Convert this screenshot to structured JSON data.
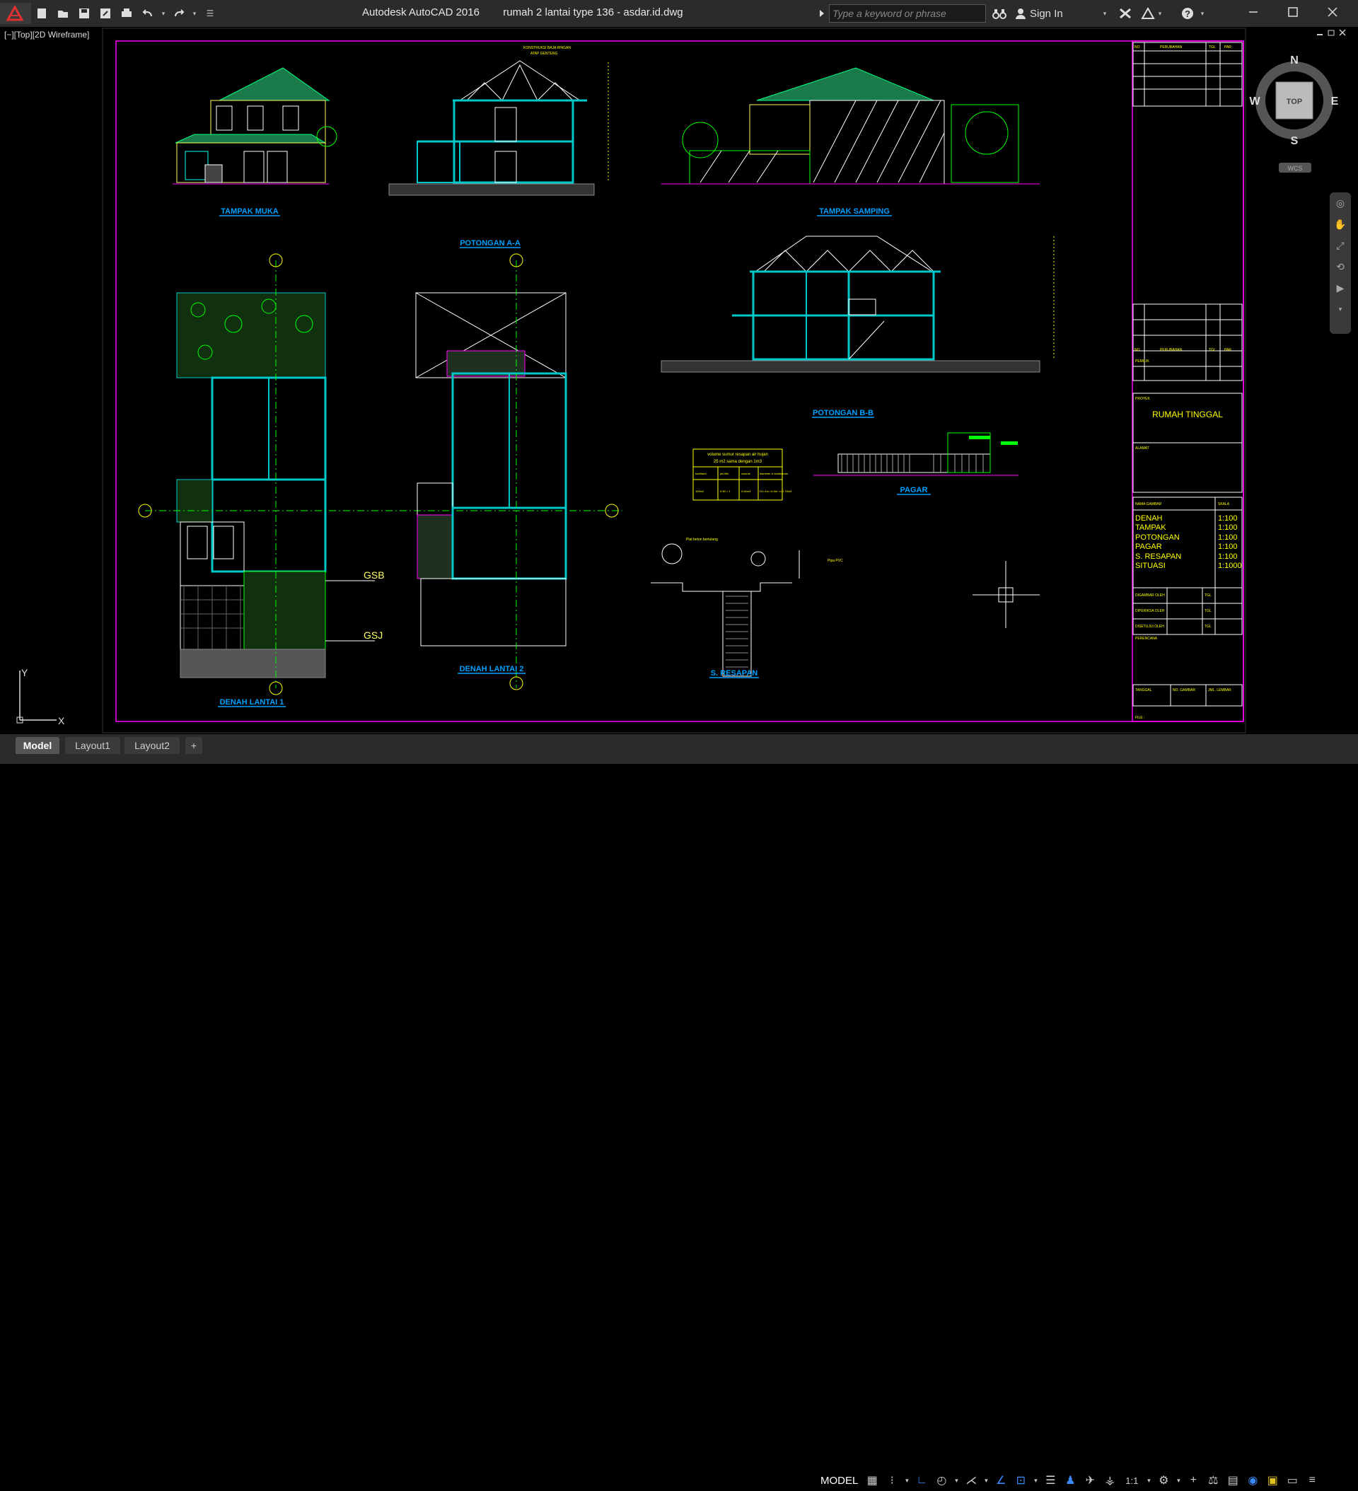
{
  "app": {
    "name": "Autodesk AutoCAD 2016",
    "file": "rumah 2 lantai type 136 - asdar.id.dwg"
  },
  "search": {
    "placeholder": "Type a keyword or phrase"
  },
  "account": {
    "signin_label": "Sign In"
  },
  "viewport": {
    "label": "[−][Top][2D Wireframe]"
  },
  "viewcube": {
    "north": "N",
    "south": "S",
    "east": "E",
    "west": "W",
    "face": "TOP",
    "wcs": "WCS"
  },
  "drawing": {
    "views": {
      "tampak_muka": "TAMPAK MUKA",
      "potongan_aa": "POTONGAN A-A",
      "tampak_samping": "TAMPAK SAMPING",
      "potongan_bb": "POTONGAN B-B",
      "denah_lantai_1": "DENAH LANTAI 1",
      "denah_lantai_2": "DENAH LANTAI 2",
      "s_resapan": "S. RESAPAN",
      "pagar": "PAGAR"
    },
    "markers": {
      "gsb": "GSB",
      "gsj": "GSJ"
    },
    "resapan_table": {
      "title_line1": "volume sumur resapan air hujan",
      "title_line2": "25 m2 sama dengan 1m3",
      "headers": [
        "koefisien",
        "jml.titik",
        "volume",
        "diameter & kedalaman"
      ],
      "row": [
        "100m2",
        "0,50 = 1",
        "0,64m3",
        "D1=1m; d=3m; v=0,78m3"
      ]
    },
    "title_block": {
      "rev_headers": [
        "NO",
        "PERUBAHAN",
        "TGL",
        "PAR"
      ],
      "rev_headers2": [
        "NO",
        "PERUBAHAN",
        "TGL",
        "PAR"
      ],
      "pemilik_label": "PEMILIK",
      "proyek_label": "PROYEK",
      "project": "RUMAH TINGGAL",
      "alamat_label": "ALAMAT",
      "nama_gambar_label": "NAMA GAMBAR",
      "skala_label": "SKALA",
      "sheet_list": [
        {
          "name": "DENAH",
          "scale": "1:100"
        },
        {
          "name": "TAMPAK",
          "scale": "1:100"
        },
        {
          "name": "POTONGAN",
          "scale": "1:100"
        },
        {
          "name": "PAGAR",
          "scale": "1:100"
        },
        {
          "name": "S. RESAPAN",
          "scale": "1:100"
        },
        {
          "name": "SITUASI",
          "scale": "1:1000"
        }
      ],
      "digambar": "DIGAMBAR OLEH",
      "diperiksa": "DIPERIKSA OLEH",
      "disetujui": "DISETUJUI OLEH",
      "tgl": "TGL",
      "perencana": "PERENCANA",
      "tanggal": "TANGGAL",
      "no_gambar": "NO. GAMBAR",
      "jml_lembar": "JML. LEMBAR",
      "file_label": "FILE :"
    }
  },
  "ucs": {
    "x": "X",
    "y": "Y"
  },
  "tabs": [
    {
      "label": "Model",
      "active": true
    },
    {
      "label": "Layout1",
      "active": false
    },
    {
      "label": "Layout2",
      "active": false
    }
  ],
  "status": {
    "model_label": "MODEL",
    "scale_label": "1:1"
  },
  "colors": {
    "background": "#000000",
    "chrome": "#2b2b2b",
    "border_magenta": "#ff00ff",
    "line_cyan": "#00c8c8",
    "line_green": "#00ff00",
    "text_yellow": "#ffff00",
    "label_blue": "#00a0ff"
  }
}
